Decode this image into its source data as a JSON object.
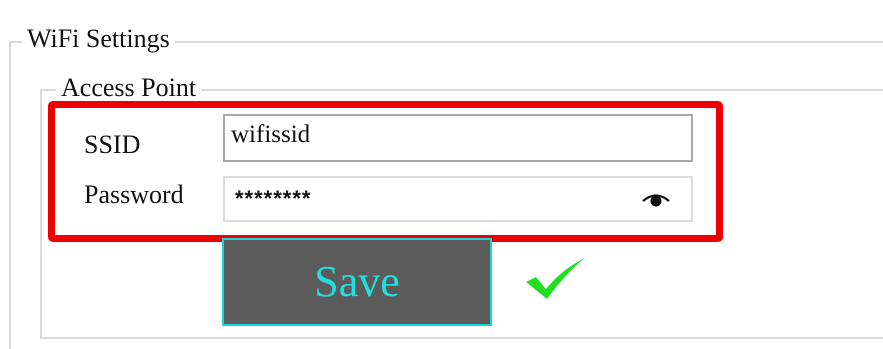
{
  "wifi_settings": {
    "group_title": "WiFi Settings",
    "access_point": {
      "group_title": "Access Point",
      "ssid_label": "SSID",
      "ssid_value": "wifissid",
      "password_label": "Password",
      "password_value": "********",
      "show_password_icon": "eye-icon",
      "save_label": "Save",
      "save_status_icon": "checkmark-icon"
    }
  },
  "colors": {
    "highlight": "#ee0000",
    "save_button_bg": "#5b5b5b",
    "save_button_text": "#22dede",
    "checkmark": "#22dd22"
  }
}
